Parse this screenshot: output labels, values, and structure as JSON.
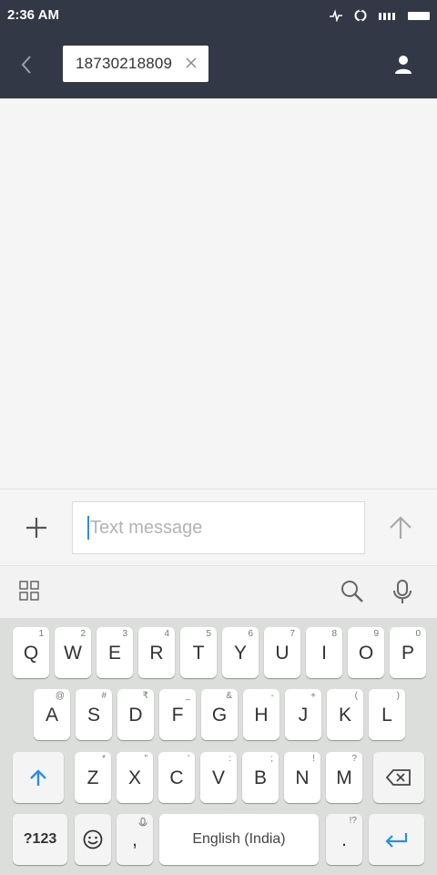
{
  "status_bar": {
    "time": "2:36 AM"
  },
  "header": {
    "recipient_chip": "18730218809"
  },
  "compose": {
    "placeholder": "Text message"
  },
  "keyboard": {
    "row1": [
      {
        "label": "Q",
        "hint": "1"
      },
      {
        "label": "W",
        "hint": "2"
      },
      {
        "label": "E",
        "hint": "3"
      },
      {
        "label": "R",
        "hint": "4"
      },
      {
        "label": "T",
        "hint": "5"
      },
      {
        "label": "Y",
        "hint": "6"
      },
      {
        "label": "U",
        "hint": "7"
      },
      {
        "label": "I",
        "hint": "8"
      },
      {
        "label": "O",
        "hint": "9"
      },
      {
        "label": "P",
        "hint": "0"
      }
    ],
    "row2": [
      {
        "label": "A",
        "hint": "@"
      },
      {
        "label": "S",
        "hint": "#"
      },
      {
        "label": "D",
        "hint": "₹"
      },
      {
        "label": "F",
        "hint": "_"
      },
      {
        "label": "G",
        "hint": "&"
      },
      {
        "label": "H",
        "hint": "-"
      },
      {
        "label": "J",
        "hint": "+"
      },
      {
        "label": "K",
        "hint": "("
      },
      {
        "label": "L",
        "hint": ")"
      }
    ],
    "row3": [
      {
        "label": "Z",
        "hint": "*"
      },
      {
        "label": "X",
        "hint": "\""
      },
      {
        "label": "C",
        "hint": "'"
      },
      {
        "label": "V",
        "hint": ":"
      },
      {
        "label": "B",
        "hint": ";"
      },
      {
        "label": "N",
        "hint": "!"
      },
      {
        "label": "M",
        "hint": "?"
      }
    ],
    "symbols_key": "?123",
    "comma_key": ",",
    "period_key": ".",
    "period_hint": "!?",
    "space_key": "English (India)"
  },
  "icons": {
    "status_icons": [
      "activity-icon",
      "sync-icon",
      "signal-icon",
      "battery-icon"
    ],
    "header": [
      "back-arrow-icon",
      "close-icon",
      "contact-icon"
    ],
    "compose": [
      "plus-icon",
      "send-arrow-icon"
    ],
    "toolbar": [
      "grid-icon",
      "search-icon",
      "microphone-icon"
    ],
    "keyboard": [
      "shift-arrow-icon",
      "backspace-icon",
      "emoji-icon",
      "enter-icon"
    ]
  },
  "colors": {
    "header_bg": "#323845",
    "background": "#f4f5f4",
    "keyboard_bg": "#dcdedc",
    "accent": "#2a8fe0"
  }
}
